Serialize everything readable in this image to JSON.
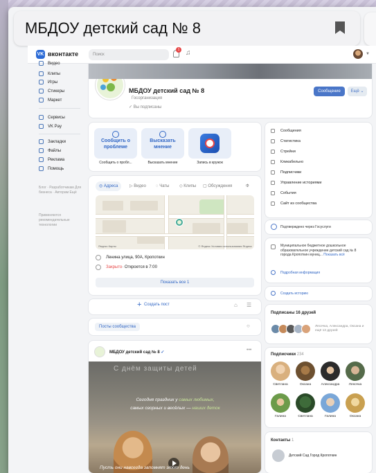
{
  "browser": {
    "address_text": "МБДОУ детский сад № 8"
  },
  "vk": {
    "logo_text": "вконтакте",
    "search_placeholder": "Поиск",
    "notifications_count": "1"
  },
  "left_nav": {
    "items": [
      "Видео",
      "Клипы",
      "Игры",
      "Стикеры",
      "Маркет",
      "Сервисы",
      "VK Pay",
      "Закладки",
      "Файлы",
      "Реклама",
      "Помощь"
    ],
    "footer_links": "Блог · Разработчикам Для бизнеса · Авторам Ещё",
    "footer_recs": "Применяются рекомендательные технологии"
  },
  "profile": {
    "name": "МБДОУ детский сад № 8",
    "subtitle": "Госорганизация",
    "status": "Вы подписаны",
    "message_button": "Сообщение",
    "more_button": "Ещё"
  },
  "apps": [
    {
      "tile": "Сообщить о проблеме",
      "caption": "Сообщить о пробл..."
    },
    {
      "tile": "Высказать мнение",
      "caption": "Высказать мнение"
    },
    {
      "tile": "",
      "caption": "Запись в кружок"
    }
  ],
  "map_card": {
    "tabs": [
      "Адреса",
      "Видео",
      "Чаты",
      "Клипы",
      "Обсуждения",
      "Ф"
    ],
    "map_credit": "© Яндекс Условия использования Яндекс",
    "map_left": "Яндекс Карты",
    "address": "Ленина улица, 90А, Кропоткин",
    "closed_label": "Закрыто",
    "opens_label": " · Откроется в 7:00",
    "show_all": "Показать все 1"
  },
  "post_bar": {
    "create_post": "Создать пост"
  },
  "feed": {
    "community_posts": "Посты сообщества"
  },
  "post": {
    "author": "МБДОУ детский сад № 8",
    "photo_title": "С днём защиты детей",
    "line1_pre": "Сегодня праздник у ",
    "line1_hl": "самых любимых,",
    "line2_pre": "самых озорных и весёлых — ",
    "line2_hl": "наших деток",
    "bottom_text": "Пусть они навсегда запомнят этот день"
  },
  "right_menu": {
    "items": [
      "Сообщения",
      "Статистика",
      "Стрейни",
      "Кликабельно",
      "Подписчики",
      "Управление историями",
      "События",
      "Сайт из сообщества"
    ]
  },
  "gosuslugi": {
    "text": "Подтверждено через Госуслуги"
  },
  "description": {
    "text": "Муниципальное бюджетное дошкольное образовательное учреждение детский сад № 8 города Кропоткин муниц...",
    "show_all": "Показать всё",
    "more_info": "Подробная информация"
  },
  "stories": {
    "create": "Создать историю"
  },
  "friends": {
    "header": "Подписаны 16 друзей",
    "names": "Лесечка, Александра, Оксана и ещё 13 друзей"
  },
  "subscribers": {
    "header": "Подписчики",
    "count": "234",
    "names": [
      "Светлана",
      "Оксана",
      "Александра",
      "Леночка",
      "Галина",
      "Светлана",
      "Галина",
      "Оксана"
    ]
  },
  "contacts": {
    "header": "Контакты",
    "count": "1",
    "name": "Детский Сад Город Кропоткин"
  },
  "colors": {
    "vk_blue": "#2c6bd6",
    "accent": "#2f65c4",
    "closed": "#e64646"
  }
}
